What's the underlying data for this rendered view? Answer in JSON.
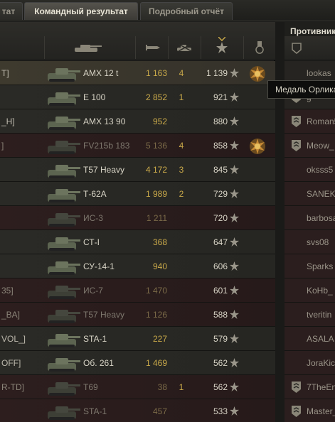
{
  "tabs": [
    {
      "label": "тат"
    },
    {
      "label": "Командный результат"
    },
    {
      "label": "Подробный отчёт"
    }
  ],
  "tooltip": "Медаль Орлика",
  "enemy_title": "Противник",
  "colors": {
    "gold": "#c9a94a",
    "tab_active": "#55534c",
    "dead_row": "#2d1e1e"
  },
  "team": [
    {
      "nick": "T]",
      "vehicle": "AMX 12 t",
      "damage": "1 163",
      "kills": "4",
      "xp": "1 139",
      "medal": true,
      "state": "me"
    },
    {
      "nick": "",
      "vehicle": "E 100",
      "damage": "2 852",
      "kills": "1",
      "xp": "921",
      "medal": false,
      "state": "alive"
    },
    {
      "nick": "_H]",
      "vehicle": "AMX 13 90",
      "damage": "952",
      "kills": "",
      "xp": "880",
      "medal": false,
      "state": "alive"
    },
    {
      "nick": "]",
      "vehicle": "FV215b 183",
      "damage": "5 136",
      "kills": "4",
      "xp": "858",
      "medal": true,
      "state": "dead"
    },
    {
      "nick": "",
      "vehicle": "T57 Heavy",
      "damage": "4 172",
      "kills": "3",
      "xp": "845",
      "medal": false,
      "state": "alive"
    },
    {
      "nick": "",
      "vehicle": "Т-62А",
      "damage": "1 989",
      "kills": "2",
      "xp": "729",
      "medal": false,
      "state": "alive"
    },
    {
      "nick": "",
      "vehicle": "ИС-3",
      "damage": "1 211",
      "kills": "",
      "xp": "720",
      "medal": false,
      "state": "dead"
    },
    {
      "nick": "",
      "vehicle": "СТ-I",
      "damage": "368",
      "kills": "",
      "xp": "647",
      "medal": false,
      "state": "alive"
    },
    {
      "nick": "",
      "vehicle": "СУ-14-1",
      "damage": "940",
      "kills": "",
      "xp": "606",
      "medal": false,
      "state": "alive"
    },
    {
      "nick": "35]",
      "vehicle": "ИС-7",
      "damage": "1 470",
      "kills": "",
      "xp": "601",
      "medal": false,
      "state": "dead"
    },
    {
      "nick": "_BA]",
      "vehicle": "T57 Heavy",
      "damage": "1 126",
      "kills": "",
      "xp": "588",
      "medal": false,
      "state": "dead"
    },
    {
      "nick": "VOL_]",
      "vehicle": "STA-1",
      "damage": "227",
      "kills": "",
      "xp": "579",
      "medal": false,
      "state": "alive"
    },
    {
      "nick": "OFF]",
      "vehicle": "Об. 261",
      "damage": "1 469",
      "kills": "",
      "xp": "562",
      "medal": false,
      "state": "alive"
    },
    {
      "nick": "R-TD]",
      "vehicle": "T69",
      "damage": "38",
      "kills": "1",
      "xp": "562",
      "medal": false,
      "state": "dead"
    },
    {
      "nick": "",
      "vehicle": "STA-1",
      "damage": "457",
      "kills": "",
      "xp": "533",
      "medal": false,
      "state": "dead"
    }
  ],
  "enemies": [
    {
      "nick": "lookas",
      "rank": false,
      "state": "alive"
    },
    {
      "nick": "g",
      "rank": true,
      "state": "alive"
    },
    {
      "nick": "Roman5",
      "rank": true,
      "state": "dead"
    },
    {
      "nick": "Meow_",
      "rank": true,
      "state": "dead"
    },
    {
      "nick": "oksss5",
      "rank": false,
      "state": "dead"
    },
    {
      "nick": "SANEK",
      "rank": false,
      "state": "dead"
    },
    {
      "nick": "barbosa",
      "rank": false,
      "state": "dead"
    },
    {
      "nick": "svs08",
      "rank": false,
      "state": "dead"
    },
    {
      "nick": "Sparks",
      "rank": false,
      "state": "dead"
    },
    {
      "nick": "KoHb_",
      "rank": false,
      "state": "dead"
    },
    {
      "nick": "tveritin",
      "rank": false,
      "state": "dead"
    },
    {
      "nick": "ASALA",
      "rank": false,
      "state": "dead"
    },
    {
      "nick": "JoraKic",
      "rank": false,
      "state": "dead"
    },
    {
      "nick": "7TheEn",
      "rank": true,
      "state": "dead"
    },
    {
      "nick": "Master_",
      "rank": true,
      "state": "dead"
    }
  ]
}
